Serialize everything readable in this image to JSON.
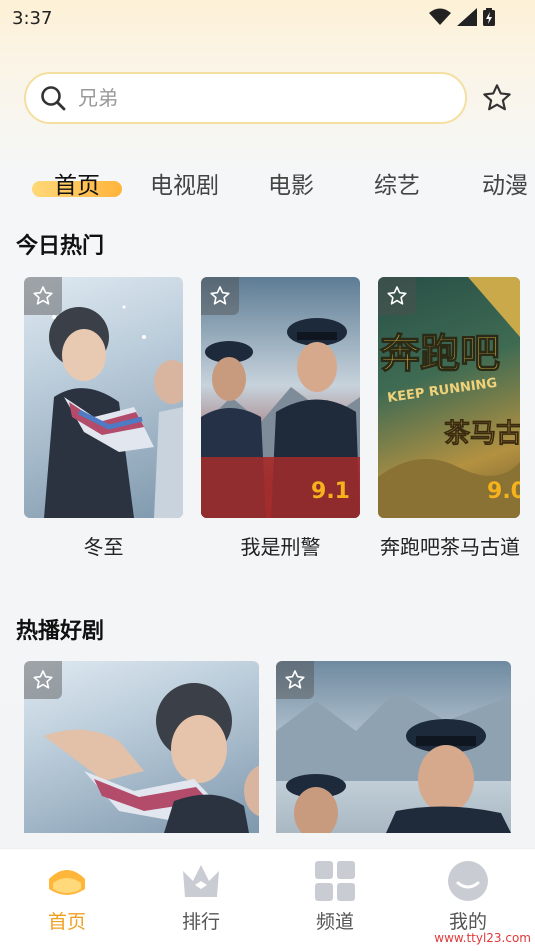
{
  "status": {
    "time": "3:37"
  },
  "search": {
    "placeholder": "兄弟"
  },
  "tabs": [
    {
      "label": "首页"
    },
    {
      "label": "电视剧"
    },
    {
      "label": "电影"
    },
    {
      "label": "综艺"
    },
    {
      "label": "动漫"
    }
  ],
  "sections": {
    "hot_today": {
      "title": "今日热门",
      "items": [
        {
          "title": "冬至"
        },
        {
          "title": "我是刑警",
          "score": "9.1"
        },
        {
          "title": "奔跑吧茶马古道",
          "score": "9.0",
          "poster_text": "奔跑吧",
          "poster_sub": "KEEP RUNNING",
          "poster_sub2": "茶马古"
        }
      ]
    },
    "hot_series": {
      "title": "热播好剧"
    }
  },
  "bottom_nav": [
    {
      "label": "首页"
    },
    {
      "label": "排行"
    },
    {
      "label": "频道"
    },
    {
      "label": "我的"
    }
  ],
  "colors": {
    "accent": "#f0a020",
    "search_border": "#f4dfa0",
    "score": "#f5b21c"
  },
  "watermark": "www.ttyl23.com"
}
